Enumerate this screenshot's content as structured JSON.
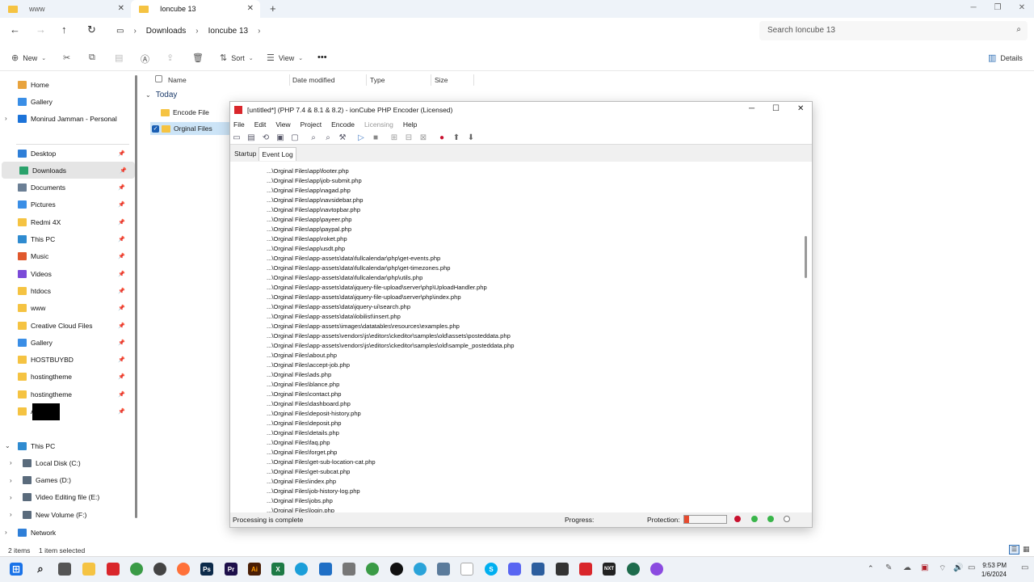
{
  "tabs": [
    {
      "label": "www",
      "active": false
    },
    {
      "label": "Ioncube 13",
      "active": true
    }
  ],
  "address": {
    "crumbs": [
      "Downloads",
      "Ioncube 13"
    ],
    "search_placeholder": "Search Ioncube 13"
  },
  "commandbar": {
    "new_label": "New",
    "sort_label": "Sort",
    "view_label": "View",
    "details_label": "Details"
  },
  "sidebar": {
    "top": [
      {
        "label": "Home",
        "icon": "home-icon",
        "color": "#e8a33d"
      },
      {
        "label": "Gallery",
        "icon": "gallery-icon",
        "color": "#3a8ee6"
      },
      {
        "label": "Monirud Jamman - Personal",
        "icon": "cloud-icon",
        "color": "#1c73d9"
      }
    ],
    "pinned": [
      {
        "label": "Desktop",
        "icon": "desktop-icon",
        "color": "#2f7fd8"
      },
      {
        "label": "Downloads",
        "icon": "download-icon",
        "color": "#2aa26b"
      },
      {
        "label": "Documents",
        "icon": "documents-icon",
        "color": "#6b7f95"
      },
      {
        "label": "Pictures",
        "icon": "pictures-icon",
        "color": "#3a8ee6"
      },
      {
        "label": "Redmi 4X",
        "icon": "folder-icon",
        "color": "#f5c342"
      },
      {
        "label": "This PC",
        "icon": "pc-icon",
        "color": "#2f8bd0"
      },
      {
        "label": "Music",
        "icon": "music-icon",
        "color": "#e0582d"
      },
      {
        "label": "Videos",
        "icon": "videos-icon",
        "color": "#7b4bd8"
      },
      {
        "label": "htdocs",
        "icon": "folder-icon",
        "color": "#f5c342"
      },
      {
        "label": "www",
        "icon": "folder-icon",
        "color": "#f5c342"
      },
      {
        "label": "Creative Cloud Files",
        "icon": "folder-icon",
        "color": "#f5c342"
      },
      {
        "label": "Gallery",
        "icon": "gallery-icon",
        "color": "#3a8ee6"
      },
      {
        "label": "HOSTBUYBD",
        "icon": "folder-icon",
        "color": "#f5c342"
      },
      {
        "label": "hostingtheme",
        "icon": "folder-icon",
        "color": "#f5c342"
      },
      {
        "label": "hostingtheme",
        "icon": "folder-icon",
        "color": "#f5c342"
      },
      {
        "label": "A",
        "icon": "folder-icon",
        "color": "#f5c342"
      }
    ],
    "tree": [
      {
        "label": "This PC",
        "icon": "pc-icon",
        "color": "#2f8bd0",
        "expanded": true
      },
      {
        "label": "Local Disk (C:)",
        "icon": "drive-icon",
        "color": "#5a6b7c"
      },
      {
        "label": "Games (D:)",
        "icon": "drive-icon",
        "color": "#5a6b7c"
      },
      {
        "label": "Video Editing file (E:)",
        "icon": "drive-icon",
        "color": "#5a6b7c"
      },
      {
        "label": "New Volume (F:)",
        "icon": "drive-icon",
        "color": "#5a6b7c"
      },
      {
        "label": "Network",
        "icon": "network-icon",
        "color": "#2f7fd8"
      }
    ]
  },
  "filelist": {
    "columns": [
      "Name",
      "Date modified",
      "Type",
      "Size"
    ],
    "group": "Today",
    "items": [
      "Encode File",
      "Orginal Files"
    ]
  },
  "encoder": {
    "title": "[untitled*] (PHP 7.4 & 8.1 & 8.2) - ionCube PHP Encoder (Licensed)",
    "menu": [
      "File",
      "Edit",
      "View",
      "Project",
      "Encode",
      "Licensing",
      "Help"
    ],
    "tabs": [
      "Startup",
      "Event Log"
    ],
    "log": [
      "...\\Orginal Files\\app\\footer.php",
      "...\\Orginal Files\\app\\job-submit.php",
      "...\\Orginal Files\\app\\nagad.php",
      "...\\Orginal Files\\app\\navsidebar.php",
      "...\\Orginal Files\\app\\navtopbar.php",
      "...\\Orginal Files\\app\\payeer.php",
      "...\\Orginal Files\\app\\paypal.php",
      "...\\Orginal Files\\app\\roket.php",
      "...\\Orginal Files\\app\\usdt.php",
      "...\\Orginal Files\\app-assets\\data\\fullcalendar\\php\\get-events.php",
      "...\\Orginal Files\\app-assets\\data\\fullcalendar\\php\\get-timezones.php",
      "...\\Orginal Files\\app-assets\\data\\fullcalendar\\php\\utils.php",
      "...\\Orginal Files\\app-assets\\data\\jquery-file-upload\\server\\php\\UploadHandler.php",
      "...\\Orginal Files\\app-assets\\data\\jquery-file-upload\\server\\php\\index.php",
      "...\\Orginal Files\\app-assets\\data\\jquery-ui\\search.php",
      "...\\Orginal Files\\app-assets\\data\\lobilist\\insert.php",
      "...\\Orginal Files\\app-assets\\images\\datatables\\resources\\examples.php",
      "...\\Orginal Files\\app-assets\\vendors\\js\\editors\\ckeditor\\samples\\old\\assets\\posteddata.php",
      "...\\Orginal Files\\app-assets\\vendors\\js\\editors\\ckeditor\\samples\\old\\sample_posteddata.php",
      "...\\Orginal Files\\about.php",
      "...\\Orginal Files\\accept-job.php",
      "...\\Orginal Files\\ads.php",
      "...\\Orginal Files\\blance.php",
      "...\\Orginal Files\\contact.php",
      "...\\Orginal Files\\dashboard.php",
      "...\\Orginal Files\\deposit-history.php",
      "...\\Orginal Files\\deposit.php",
      "...\\Orginal Files\\details.php",
      "...\\Orginal Files\\faq.php",
      "...\\Orginal Files\\forget.php",
      "...\\Orginal Files\\get-sub-location-cat.php",
      "...\\Orginal Files\\get-subcat.php",
      "...\\Orginal Files\\index.php",
      "...\\Orginal Files\\job-history-log.php",
      "...\\Orginal Files\\jobs.php",
      "...\\Orginal Files\\login.php"
    ],
    "status": "Processing is complete",
    "progress_label": "Progress:",
    "protection_label": "Protection:",
    "protection_level": 0.12
  },
  "statusbar": {
    "items_count": "2 items",
    "selected": "1 item selected"
  },
  "clock": {
    "time": "9:53 PM",
    "date": "1/6/2024"
  }
}
